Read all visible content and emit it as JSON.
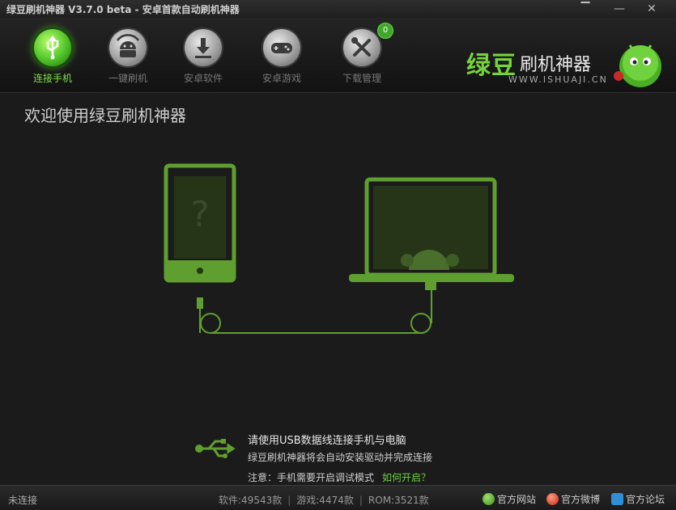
{
  "window": {
    "title": "绿豆刷机神器 V3.7.0 beta - 安卓首款自动刷机神器"
  },
  "nav": [
    {
      "label": "连接手机",
      "active": true
    },
    {
      "label": "一键刷机"
    },
    {
      "label": "安卓软件"
    },
    {
      "label": "安卓游戏"
    },
    {
      "label": "下载管理",
      "badge": "0"
    }
  ],
  "logo": {
    "brand_big": "绿豆",
    "brand_rest": "刷机神器",
    "url": "WWW.ISHUAJI.CN"
  },
  "main": {
    "welcome": "欢迎使用绿豆刷机神器",
    "instruction_title": "请使用USB数据线连接手机与电脑",
    "instruction_sub": "绿豆刷机神器将会自动安装驱动并完成连接",
    "note": "注意：手机需要开启调试模式",
    "howto_link": "如何开启？"
  },
  "statusbar": {
    "status": "未连接",
    "software": "软件:49543款",
    "games": "游戏:4474款",
    "rom": "ROM:3521款",
    "links": [
      "官方网站",
      "官方微博",
      "官方论坛"
    ]
  },
  "colors": {
    "accent": "#6fd23e",
    "illustration": "#5f9f2f"
  }
}
